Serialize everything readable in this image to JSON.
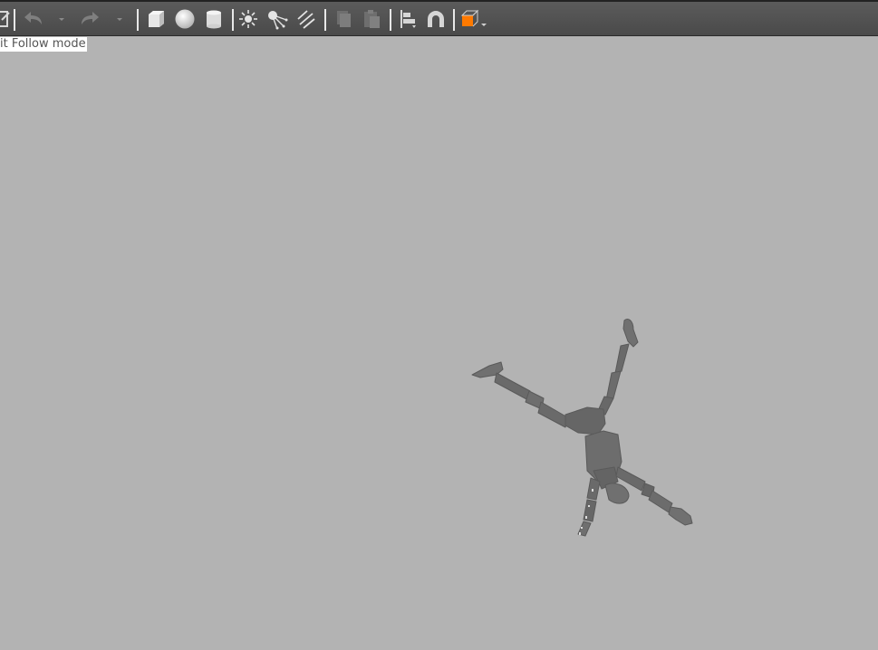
{
  "toolbar": {
    "items": [
      {
        "name": "view-icon"
      },
      {
        "name": "undo-icon"
      },
      {
        "name": "undo-dropdown-icon"
      },
      {
        "name": "redo-icon"
      },
      {
        "name": "redo-dropdown-icon"
      },
      {
        "name": "box-shape-icon"
      },
      {
        "name": "sphere-shape-icon"
      },
      {
        "name": "cylinder-shape-icon"
      },
      {
        "name": "point-light-icon"
      },
      {
        "name": "spot-light-icon"
      },
      {
        "name": "directional-light-icon"
      },
      {
        "name": "copy-icon"
      },
      {
        "name": "paste-icon"
      },
      {
        "name": "align-icon"
      },
      {
        "name": "snap-magnet-icon"
      },
      {
        "name": "view-angle-icon"
      }
    ],
    "accent_color": "#ff7a00"
  },
  "viewport": {
    "mode_label": "it Follow mode",
    "background_color": "#b3b3b3",
    "model_color": "#6e6e6e"
  }
}
